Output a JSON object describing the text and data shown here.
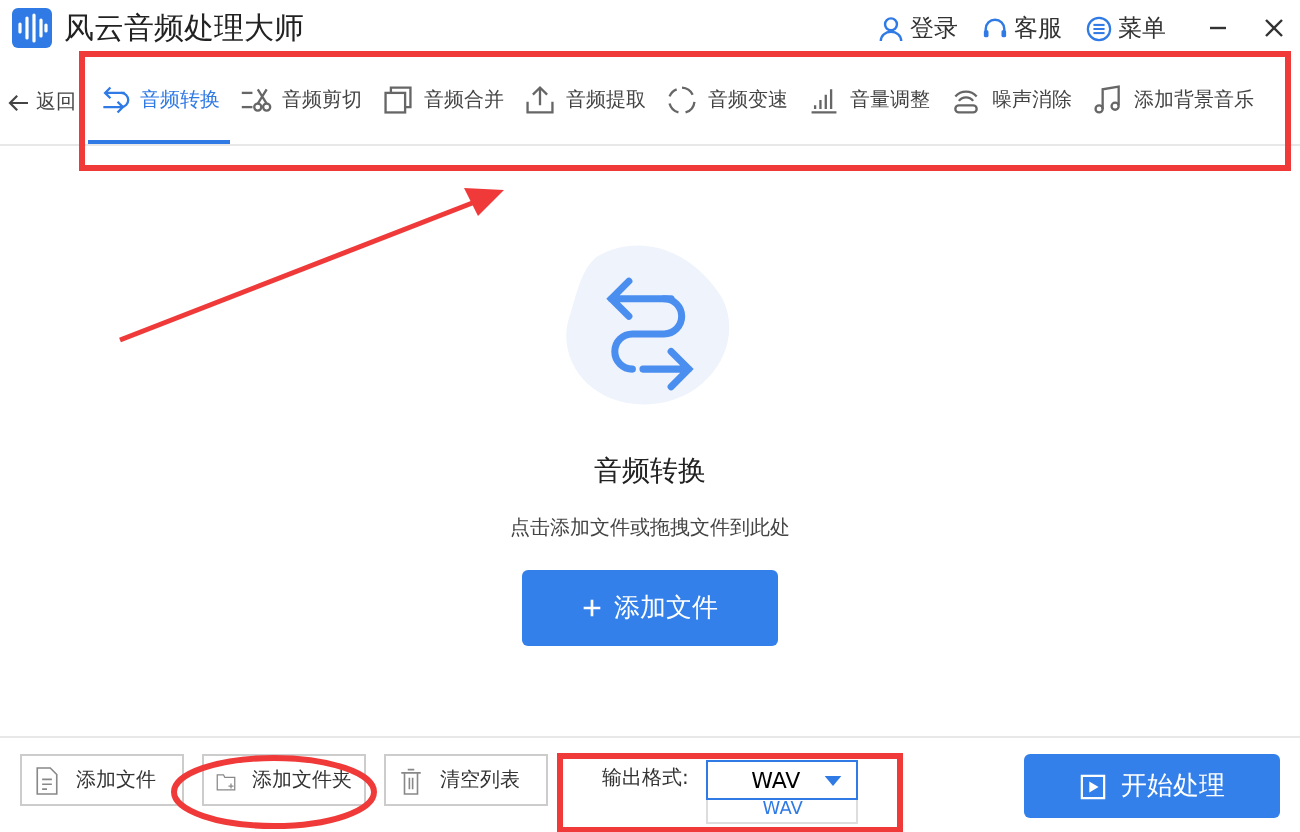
{
  "window": {
    "title": "风云音频处理大师"
  },
  "header_actions": [
    {
      "kind": "user",
      "label": "登录"
    },
    {
      "kind": "headset",
      "label": "客服"
    },
    {
      "kind": "menu",
      "label": "菜单"
    }
  ],
  "back": {
    "label": "返回"
  },
  "tabs": [
    {
      "kind": "convert",
      "label": "音频转换",
      "selected": true
    },
    {
      "kind": "cut",
      "label": "音频剪切",
      "selected": false
    },
    {
      "kind": "merge",
      "label": "音频合并",
      "selected": false
    },
    {
      "kind": "extract",
      "label": "音频提取",
      "selected": false
    },
    {
      "kind": "speed",
      "label": "音频变速",
      "selected": false
    },
    {
      "kind": "volume",
      "label": "音量调整",
      "selected": false
    },
    {
      "kind": "noise",
      "label": "噪声消除",
      "selected": false
    },
    {
      "kind": "music",
      "label": "添加背景音乐",
      "selected": false
    }
  ],
  "main": {
    "title": "音频转换",
    "hint": "点击添加文件或拖拽文件到此处",
    "add_button": "添加文件"
  },
  "bottom": {
    "buttons": [
      {
        "kind": "file",
        "label": "添加文件"
      },
      {
        "kind": "folder",
        "label": "添加文件夹"
      },
      {
        "kind": "trash",
        "label": "清空列表"
      }
    ],
    "format_label": "输出格式:",
    "format_value": "WAV",
    "format_option": "WAV",
    "start_button": "开始处理"
  }
}
